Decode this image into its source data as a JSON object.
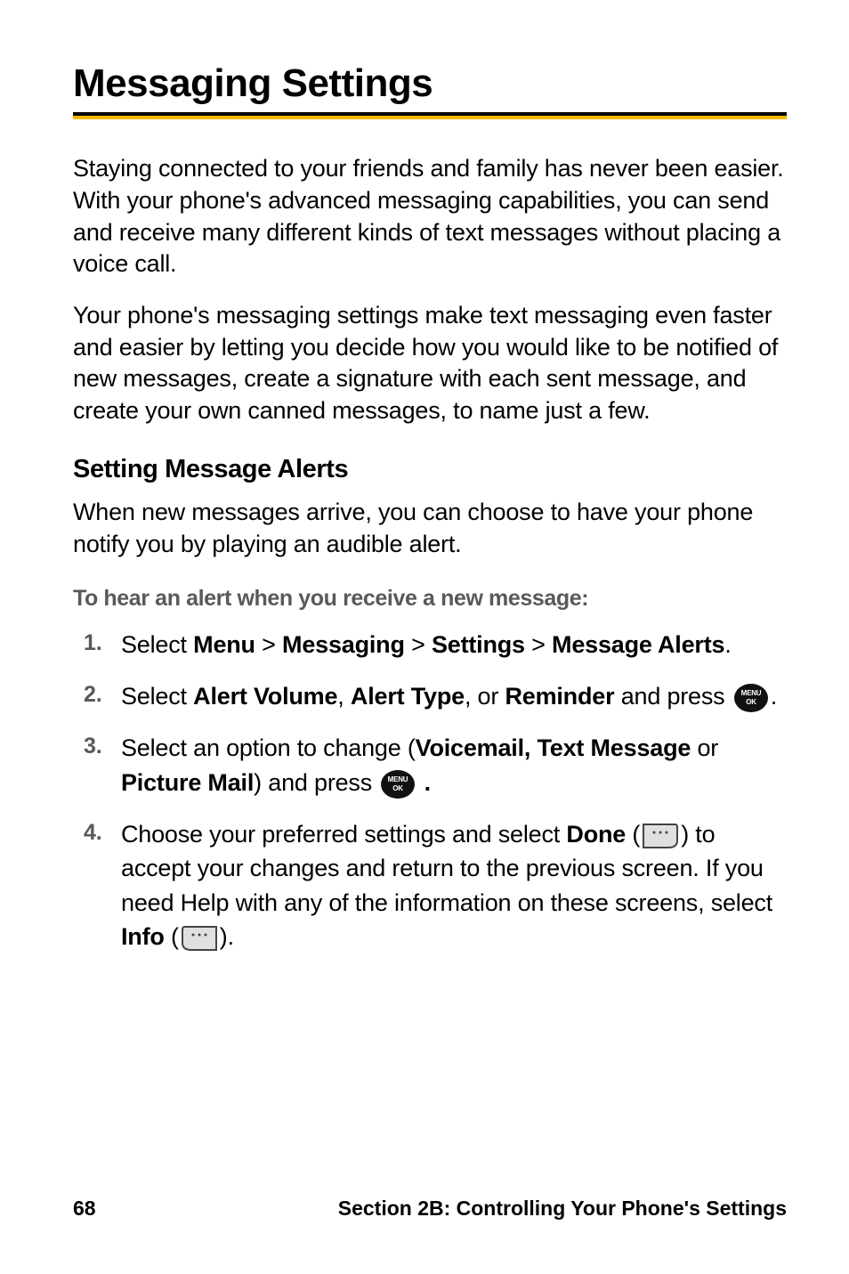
{
  "title": "Messaging Settings",
  "para1": "Staying connected to your friends and family has never been easier. With your phone's advanced messaging capabilities, you can send and receive many different kinds of text messages without placing a voice call.",
  "para2": "Your phone's messaging settings make text messaging even faster and easier by letting you decide how you would like to be notified of new messages, create a signature with each sent message, and create your own canned messages, to name just a few.",
  "h3": "Setting Message Alerts",
  "sub": "When new messages arrive, you can choose to have your phone notify you by playing an audible alert.",
  "leadin": "To hear an alert when you receive a new message:",
  "steps": {
    "n1": "1.",
    "n2": "2.",
    "n3": "3.",
    "n4": "4.",
    "s1_a": "Select ",
    "s1_menu": "Menu",
    "s1_gt1": " > ",
    "s1_messaging": "Messaging",
    "s1_gt2": " > ",
    "s1_settings": "Settings",
    "s1_gt3": " > ",
    "s1_ma": "Message Alerts",
    "s1_end": ".",
    "s2_a": "Select ",
    "s2_av": "Alert Volume",
    "s2_c1": ", ",
    "s2_at": "Alert Type",
    "s2_c2": ", or ",
    "s2_rem": "Reminder",
    "s2_and": " and press ",
    "s2_end": ".",
    "s3_a": "Select an option to change (",
    "s3_vt": "Voicemail, Text Message",
    "s3_or": " or ",
    "s3_pm": "Picture Mail",
    "s3_b": ") and press ",
    "s3_end": " .",
    "s4_a": "Choose your preferred settings and select ",
    "s4_done": "Done",
    "s4_b": " (",
    "s4_c": ") to accept your changes and return to the previous screen. If you need Help with any of the information on these screens, select ",
    "s4_info": "Info",
    "s4_d": " (",
    "s4_e": ")."
  },
  "footer": {
    "page": "68",
    "section": "Section 2B: Controlling Your Phone's Settings"
  }
}
